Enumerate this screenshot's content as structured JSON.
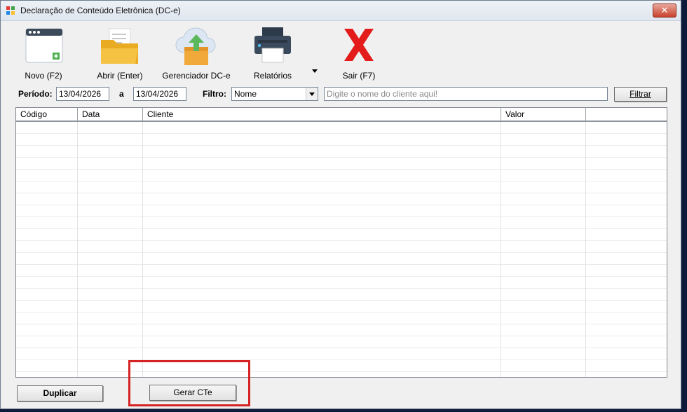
{
  "window": {
    "title": "Declaração de Conteúdo Eletrônica (DC-e)",
    "close_glyph": "✕"
  },
  "toolbar": {
    "new_label": "Novo (F2)",
    "open_label": "Abrir (Enter)",
    "manager_label": "Gerenciador DC-e",
    "reports_label": "Relatórios",
    "exit_label": "Sair (F7)"
  },
  "filters": {
    "period_label": "Período:",
    "date_from": "13/04/2026",
    "to_label": "a",
    "date_to": "13/04/2026",
    "filter_label": "Filtro:",
    "filter_selected": "Nome",
    "search_placeholder": "Digite o nome do cliente aqui!",
    "filter_button": "Filtrar"
  },
  "grid": {
    "columns": [
      "Código",
      "Data",
      "Cliente",
      "Valor"
    ],
    "rows": []
  },
  "footer": {
    "duplicate_button": "Duplicar",
    "generate_button": "Gerar CTe"
  },
  "colors": {
    "highlight": "#d52222",
    "exit_red": "#e31b1b",
    "folder_yellow": "#f6c244"
  }
}
